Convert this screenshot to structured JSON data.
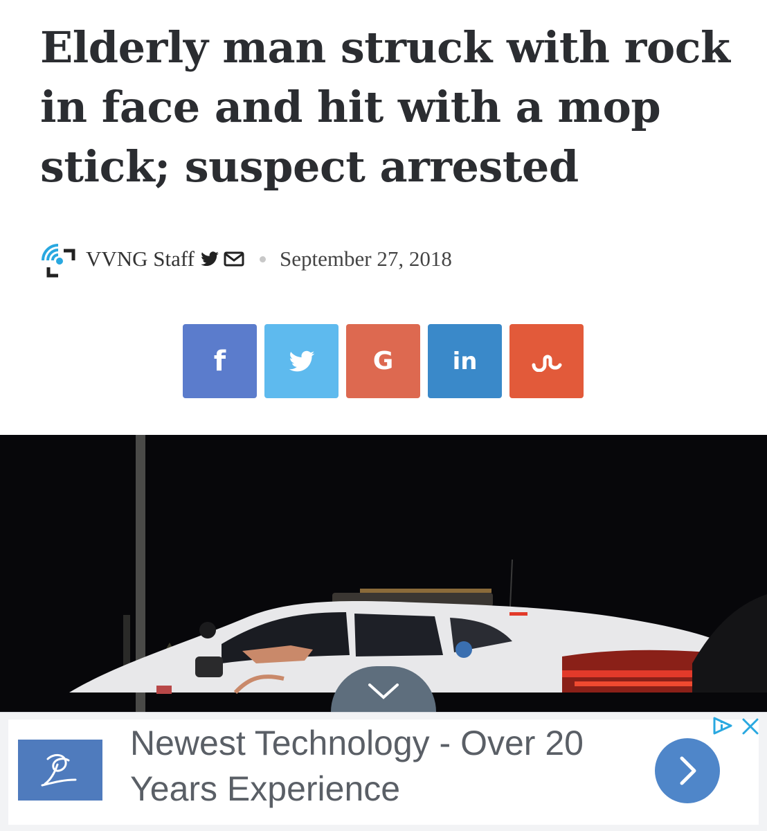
{
  "article": {
    "headline": "Elderly man struck with rock in face and hit with a mop stick; suspect arrested",
    "author": "VVNG Staff",
    "date": "September 27, 2018"
  },
  "share": {
    "buttons": [
      {
        "network": "facebook",
        "label": "f",
        "color": "#5b7ccc"
      },
      {
        "network": "twitter",
        "icon": "twitter-bird-icon",
        "color": "#5ebaee"
      },
      {
        "network": "google",
        "label": "G",
        "color": "#dd6950"
      },
      {
        "network": "linkedin",
        "label": "in",
        "color": "#3a89c9"
      },
      {
        "network": "stumbleupon",
        "icon": "stumbleupon-icon",
        "color": "#e25a3a"
      }
    ]
  },
  "hero_image": {
    "subject": "police patrol car at night",
    "colors": {
      "sky": "#07070a",
      "car": "#e8e8ea",
      "taillight": "#e23a2a"
    }
  },
  "ad": {
    "headline": "Newest Technology - Over 20 Years Experience",
    "cta_icon": "chevron-right-icon",
    "colors": {
      "logo_bg": "#4f7bbd",
      "cta": "#4f86c9",
      "adchoices": "#29a8e0"
    }
  },
  "icons": {
    "collapse": "chevron-down-icon",
    "adchoices": "adchoices-icon",
    "close": "close-icon"
  }
}
